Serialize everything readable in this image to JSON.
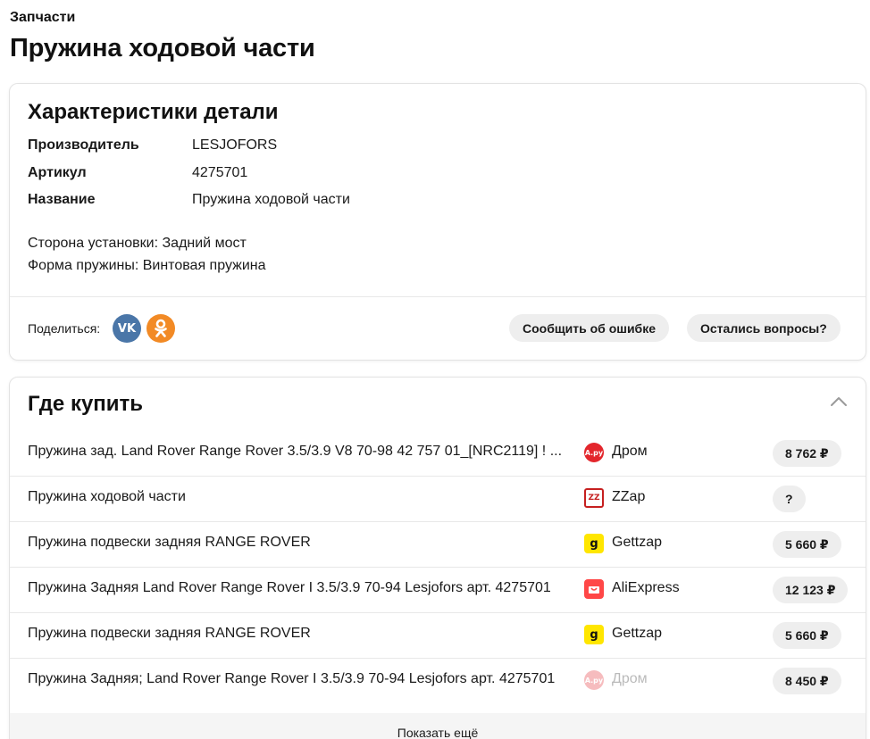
{
  "breadcrumb": "Запчасти",
  "page_title": "Пружина ходовой части",
  "specs": {
    "title": "Характеристики детали",
    "rows": [
      {
        "key": "Производитель",
        "value": "LESJOFORS"
      },
      {
        "key": "Артикул",
        "value": "4275701"
      },
      {
        "key": "Название",
        "value": "Пружина ходовой части"
      }
    ],
    "notes": [
      "Сторона установки: Задний мост",
      "Форма пружины: Винтовая пружина"
    ]
  },
  "share": {
    "label": "Поделиться:",
    "vk_text": "VK"
  },
  "buttons": {
    "report": "Сообщить об ошибке",
    "ask": "Остались вопросы?"
  },
  "buy": {
    "title": "Где купить",
    "offers": [
      {
        "title": "Пружина зад. Land Rover Range Rover 3.5/3.9 V8 70-98 42 757 01_[NRC2119] ! ...",
        "shop": "Дром",
        "shop_icon": "drom-icon",
        "price": "8 762 ₽"
      },
      {
        "title": "Пружина ходовой части",
        "shop": "ZZap",
        "shop_icon": "zzap-icon",
        "price": "?"
      },
      {
        "title": "Пружина подвески задняя RANGE ROVER",
        "shop": "Gettzap",
        "shop_icon": "gettzap-icon",
        "price": "5 660 ₽"
      },
      {
        "title": "Пружина Задняя Land Rover Range Rover I 3.5/3.9 70-94 Lesjofors арт. 4275701",
        "shop": "AliExpress",
        "shop_icon": "aliexpress-icon",
        "price": "12 123 ₽"
      },
      {
        "title": "Пружина подвески задняя RANGE ROVER",
        "shop": "Gettzap",
        "shop_icon": "gettzap-icon",
        "price": "5 660 ₽"
      },
      {
        "title": "Пружина Задняя; Land Rover Range Rover I 3.5/3.9 70-94 Lesjofors арт. 4275701",
        "shop": "Дром",
        "shop_icon": "drom-icon",
        "price": "8 450 ₽"
      }
    ],
    "show_more": "Показать ещё"
  },
  "colors": {
    "vk": "#4a76a8",
    "ok": "#f28a25",
    "drom": "#e3262c",
    "zzap": "#c62020",
    "gettzap": "#ffe600",
    "aliexpress": "#ff4747",
    "pill_bg": "#eeeeee"
  }
}
